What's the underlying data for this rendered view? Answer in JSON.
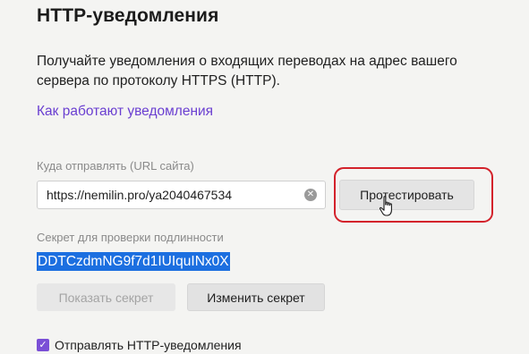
{
  "section": {
    "title": "HTTP-уведомления",
    "description": "Получайте уведомления о входящих переводах на адрес вашего сервера по протоколу HTTPS (HTTP).",
    "help_link": "Как работают уведомления"
  },
  "url_field": {
    "label": "Куда отправлять (URL сайта)",
    "value": "https://nemilin.pro/ya2040467534",
    "clear_icon": "clear-icon"
  },
  "test_button": {
    "label": "Протестировать",
    "highlight_color": "#d3222b"
  },
  "secret": {
    "label": "Секрет для проверки подлинности",
    "value": "DDTCzdmNG9f7d1IUIquINx0X",
    "selection_color": "#1c6fe0"
  },
  "buttons": {
    "show_secret": "Показать секрет",
    "change_secret": "Изменить секрет"
  },
  "notifications_checkbox": {
    "label": "Отправлять HTTP-уведомления",
    "checked": true,
    "accent_color": "#7a4fd6"
  },
  "colors": {
    "link": "#6a3fd1",
    "background": "#f4f4f2"
  }
}
